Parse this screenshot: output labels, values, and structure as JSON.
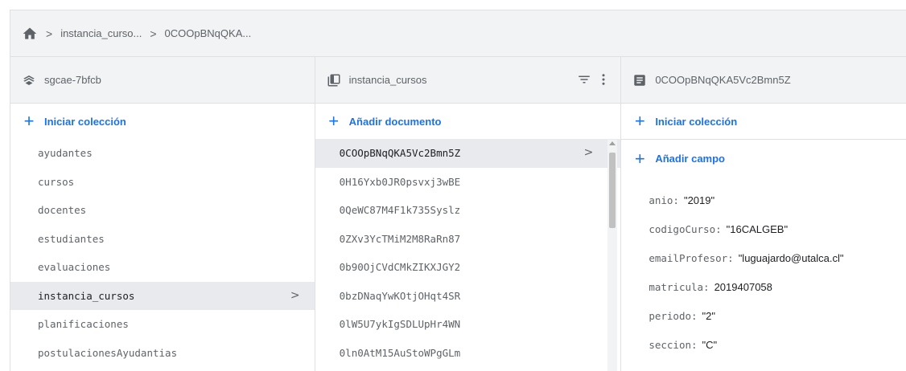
{
  "breadcrumb": {
    "home_icon": "home-icon",
    "items": [
      "instancia_curso...",
      "0COOpBNqQKA..."
    ]
  },
  "panels": {
    "project": {
      "icon": "firestore-icon",
      "title": "sgcae-7bfcb",
      "action_label": "Iniciar colección",
      "collections": [
        "ayudantes",
        "cursos",
        "docentes",
        "estudiantes",
        "evaluaciones",
        "instancia_cursos",
        "planificaciones",
        "postulacionesAyudantias"
      ],
      "selected_index": 5
    },
    "collection": {
      "icon": "collection-icon",
      "title": "instancia_cursos",
      "filter_icon": "filter-icon",
      "menu_icon": "more-vert-icon",
      "action_label": "Añadir documento",
      "documents": [
        "0COOpBNqQKA5Vc2Bmn5Z",
        "0H16Yxb0JR0psvxj3wBE",
        "0QeWC87M4F1k735Syslz",
        "0ZXv3YcTMiM2M8RaRn87",
        "0b90OjCVdCMkZIKXJGY2",
        "0bzDNaqYwKOtjOHqt4SR",
        "0lW5U7ykIgSDLUpHr4WN",
        "0ln0AtM15AuStoWPgGLm"
      ],
      "selected_index": 0
    },
    "document": {
      "icon": "document-icon",
      "title": "0COOpBNqQKA5Vc2Bmn5Z",
      "action_collection_label": "Iniciar colección",
      "action_field_label": "Añadir campo",
      "fields": [
        {
          "key": "anio",
          "value": "\"2019\""
        },
        {
          "key": "codigoCurso",
          "value": "\"16CALGEB\""
        },
        {
          "key": "emailProfesor",
          "value": "\"luguajardo@utalca.cl\""
        },
        {
          "key": "matricula",
          "value": "2019407058"
        },
        {
          "key": "periodo",
          "value": "\"2\""
        },
        {
          "key": "seccion",
          "value": "\"C\""
        }
      ]
    }
  },
  "colors": {
    "accent": "#1a73e8",
    "header_bg": "#f1f3f4",
    "selected_bg": "#e8eaed"
  }
}
